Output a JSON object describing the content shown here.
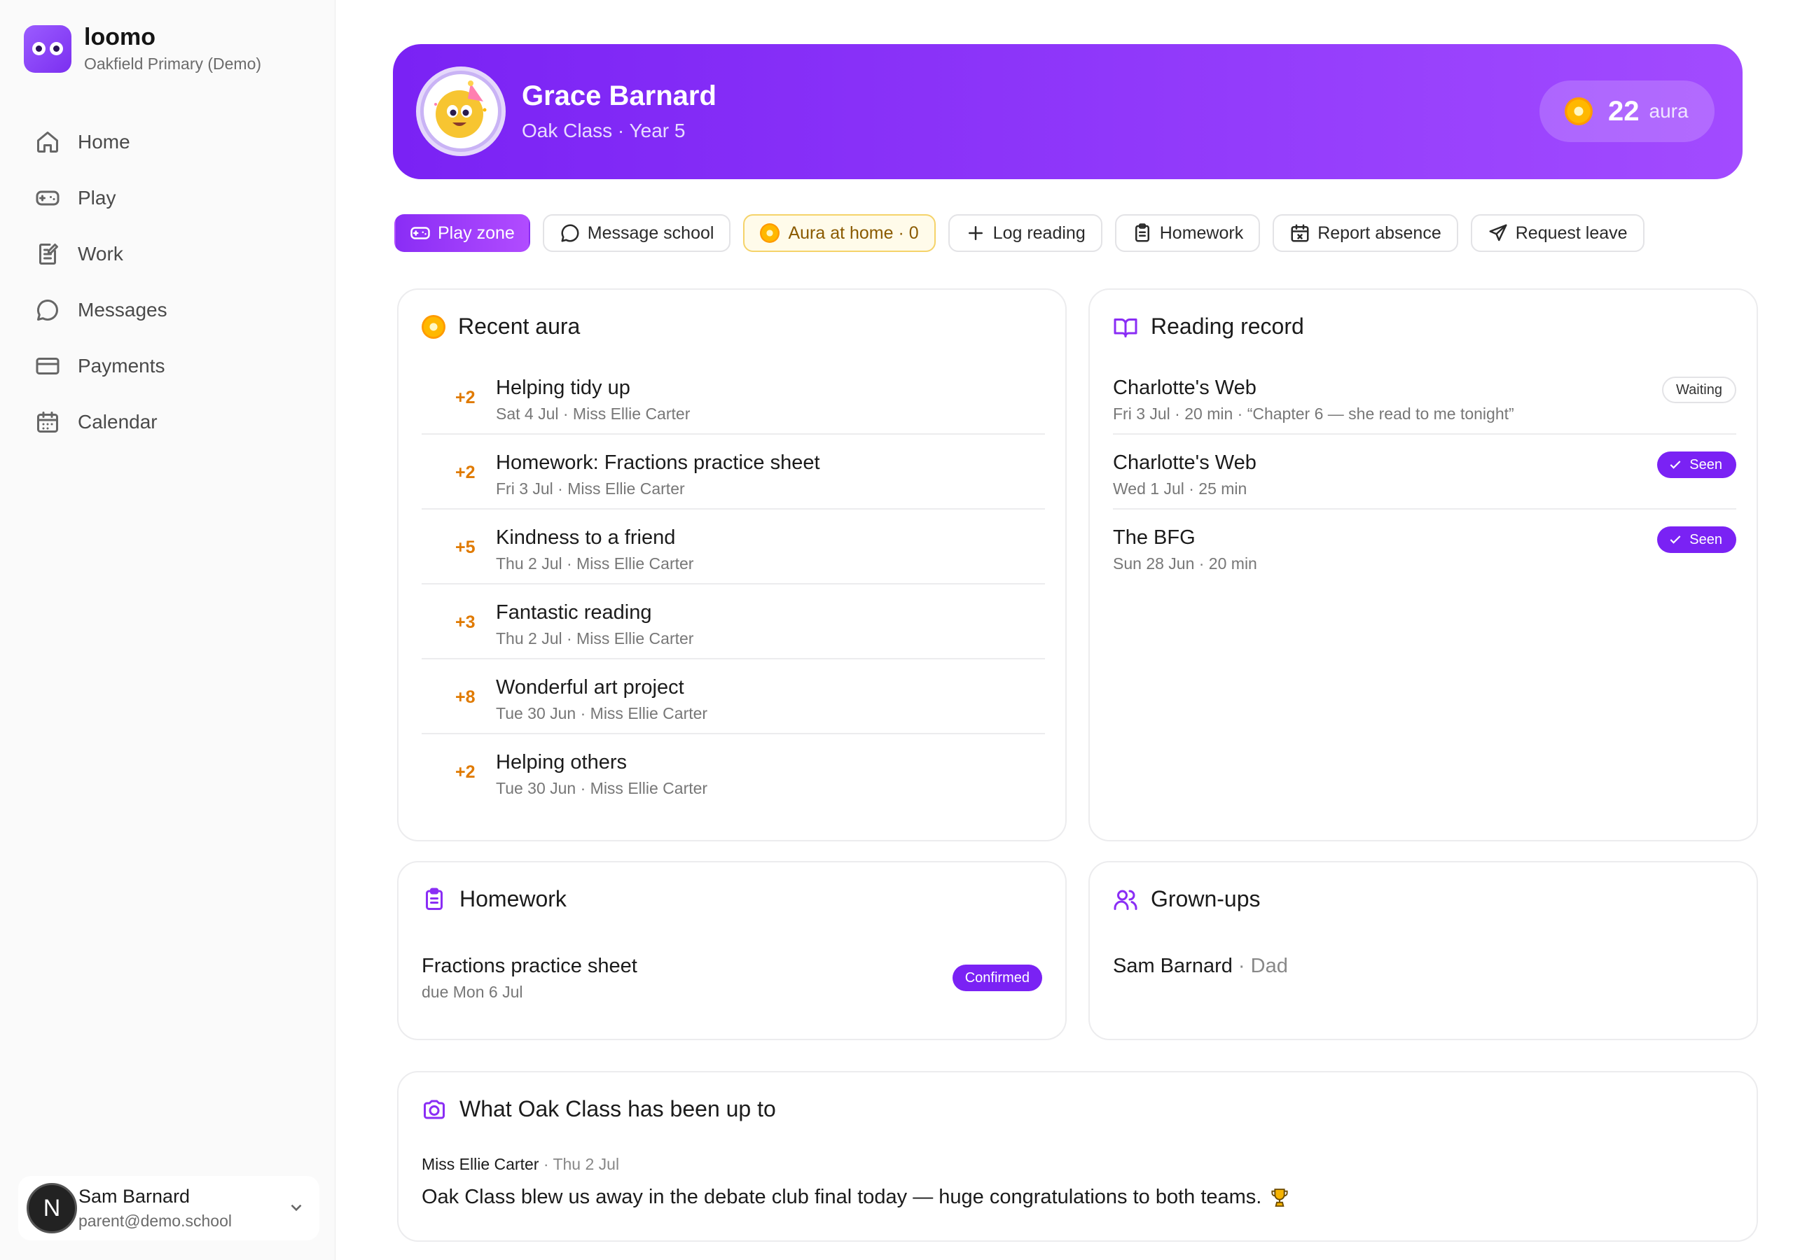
{
  "app": {
    "name": "loomo",
    "school": "Oakfield Primary (Demo)"
  },
  "nav": [
    {
      "label": "Home",
      "icon": "home-icon"
    },
    {
      "label": "Play",
      "icon": "gamepad-icon"
    },
    {
      "label": "Work",
      "icon": "work-icon"
    },
    {
      "label": "Messages",
      "icon": "message-icon"
    },
    {
      "label": "Payments",
      "icon": "card-icon"
    },
    {
      "label": "Calendar",
      "icon": "calendar-icon"
    }
  ],
  "user": {
    "initial": "N",
    "name": "Sam Barnard",
    "email": "parent@demo.school"
  },
  "hero": {
    "name": "Grace Barnard",
    "class": "Oak Class · Year 5",
    "aura_value": "22",
    "aura_label": "aura"
  },
  "actions": {
    "play_zone": "Play zone",
    "message_school": "Message school",
    "aura_at_home": "Aura at home · 0",
    "log_reading": "Log reading",
    "homework": "Homework",
    "report_absence": "Report absence",
    "request_leave": "Request leave"
  },
  "recent_aura": {
    "title": "Recent aura",
    "items": [
      {
        "points": "+2",
        "title": "Helping tidy up",
        "meta": "Sat 4 Jul · Miss Ellie Carter"
      },
      {
        "points": "+2",
        "title": "Homework: Fractions practice sheet",
        "meta": "Fri 3 Jul · Miss Ellie Carter"
      },
      {
        "points": "+5",
        "title": "Kindness to a friend",
        "meta": "Thu 2 Jul · Miss Ellie Carter"
      },
      {
        "points": "+3",
        "title": "Fantastic reading",
        "meta": "Thu 2 Jul · Miss Ellie Carter"
      },
      {
        "points": "+8",
        "title": "Wonderful art project",
        "meta": "Tue 30 Jun · Miss Ellie Carter"
      },
      {
        "points": "+2",
        "title": "Helping others",
        "meta": "Tue 30 Jun · Miss Ellie Carter"
      }
    ]
  },
  "reading_record": {
    "title": "Reading record",
    "items": [
      {
        "title": "Charlotte's Web",
        "meta": "Fri 3 Jul · 20 min · “Chapter 6 — she read to me tonight”",
        "status": "Waiting"
      },
      {
        "title": "Charlotte's Web",
        "meta": "Wed 1 Jul · 25 min",
        "status": "Seen"
      },
      {
        "title": "The BFG",
        "meta": "Sun 28 Jun · 20 min",
        "status": "Seen"
      }
    ]
  },
  "homework": {
    "title": "Homework",
    "item_title": "Fractions practice sheet",
    "item_due": "due Mon 6 Jul",
    "item_status": "Confirmed"
  },
  "grownups": {
    "title": "Grown-ups",
    "name": "Sam Barnard",
    "relation": "· Dad"
  },
  "class_feed": {
    "title": "What Oak Class has been up to",
    "author": "Miss Ellie Carter",
    "date": "· Thu 2 Jul",
    "text": "Oak Class blew us away in the debate club final today — huge congratulations to both teams."
  },
  "colors": {
    "brand": "#7a22f4",
    "aura": "#ffb800",
    "points": "#e07a00"
  }
}
